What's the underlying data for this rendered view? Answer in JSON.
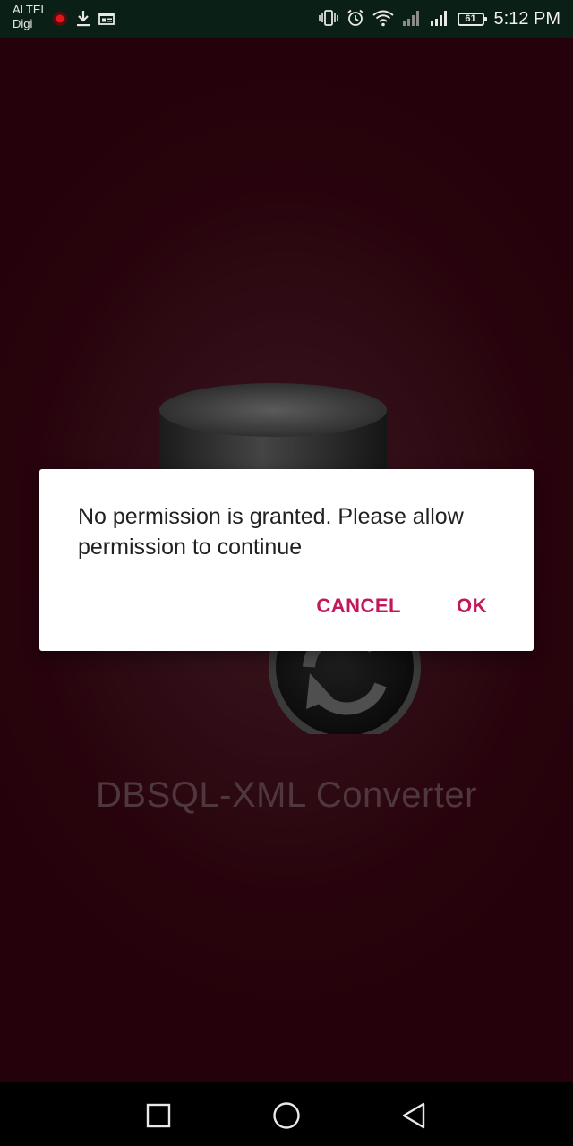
{
  "status_bar": {
    "carrier_primary": "ALTEL",
    "carrier_secondary": "Digi",
    "time": "5:12 PM",
    "battery_level": "61",
    "left_icons": [
      "screen-record-icon",
      "download-icon",
      "news-icon"
    ],
    "right_icons": [
      "vibrate-icon",
      "alarm-icon",
      "wifi-icon",
      "signal-icon",
      "signal-icon",
      "battery-icon"
    ]
  },
  "app": {
    "title": "DBSQL-XML Converter",
    "background_color": "#4a1422",
    "logo_icon": "database-convert-icon"
  },
  "dialog": {
    "message": "No permission is granted. Please allow permission to continue",
    "cancel_label": "CANCEL",
    "ok_label": "OK",
    "accent_color": "#c2185b"
  },
  "nav_bar": {
    "icons": [
      "recents-square-icon",
      "home-circle-icon",
      "back-triangle-icon"
    ]
  }
}
